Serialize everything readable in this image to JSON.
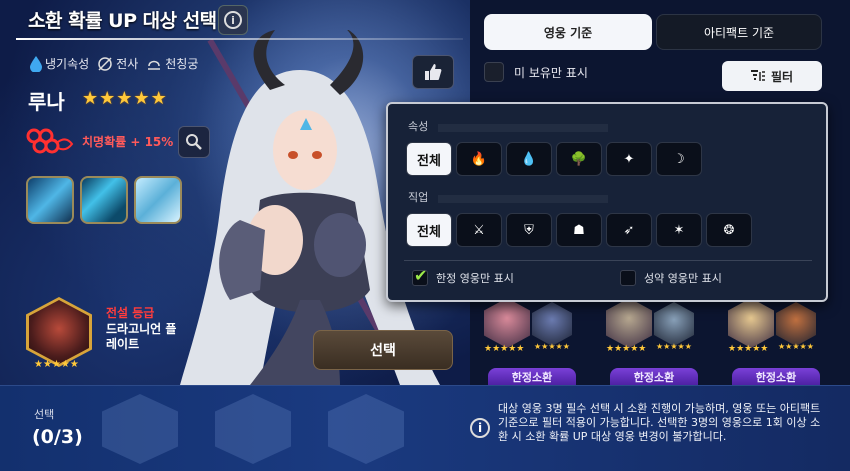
{
  "header": {
    "title": "소환 확률 UP 대상 선택",
    "info_glyph": "i"
  },
  "hero": {
    "attributes": [
      {
        "icon": "water-drop-icon",
        "label": "냉기속성"
      },
      {
        "icon": "warrior-class-icon",
        "label": "전사"
      },
      {
        "icon": "constellation-icon",
        "label": "천칭궁"
      }
    ],
    "name": "루나",
    "star_count": 5,
    "crit_text": "치명확률 + 15%"
  },
  "equipment": {
    "grade": "전설 등급",
    "name": "드라고니언 플레이트",
    "star_count": 5
  },
  "select_button": "선택",
  "tabs": {
    "hero": "영웅 기준",
    "artifact": "아티팩트 기준"
  },
  "owned_only": "미 보유만 표시",
  "filter_button": "필터",
  "filter_popup": {
    "attribute_label": "속성",
    "attribute_chips": [
      {
        "name": "attr-all",
        "text": "전체",
        "active": true
      },
      {
        "name": "fire-icon",
        "glyph": "🔥"
      },
      {
        "name": "ice-icon",
        "glyph": "💧"
      },
      {
        "name": "earth-icon",
        "glyph": "🌳"
      },
      {
        "name": "light-icon",
        "glyph": "✦"
      },
      {
        "name": "dark-icon",
        "glyph": "☽"
      }
    ],
    "class_label": "직업",
    "class_chips": [
      {
        "name": "class-all",
        "text": "전체",
        "active": true
      },
      {
        "name": "warrior-icon",
        "glyph": "⚔"
      },
      {
        "name": "knight-icon",
        "glyph": "⛨"
      },
      {
        "name": "thief-icon",
        "glyph": "☗"
      },
      {
        "name": "ranger-icon",
        "glyph": "➶"
      },
      {
        "name": "mage-icon",
        "glyph": "✶"
      },
      {
        "name": "soul-weaver-icon",
        "glyph": "❂"
      }
    ],
    "limited_only": "한정 영웅만 표시",
    "constellation_only": "성약 영웅만 표시"
  },
  "hero_cards": [
    {
      "label": "한정소환",
      "portrait_color": "#d98a9a",
      "art_color": "#6b7bb0"
    },
    {
      "label": "한정소환",
      "portrait_color": "#b7a890",
      "art_color": "#88a0b8"
    },
    {
      "label": "한정소환",
      "portrait_color": "#e6c890",
      "art_color": "#c07040"
    }
  ],
  "bottom": {
    "select_label": "선택",
    "select_count": "(0/3)",
    "notice": "대상 영웅 3명 필수 선택 시 소환 진행이 가능하며, 영웅 또는 아티팩트 기준으로 필터 적용이 가능합니다. 선택한 3명의 영웅으로 1회 이상 소환 시 소환 확률 UP 대상 영웅 변경이 불가합니다."
  }
}
